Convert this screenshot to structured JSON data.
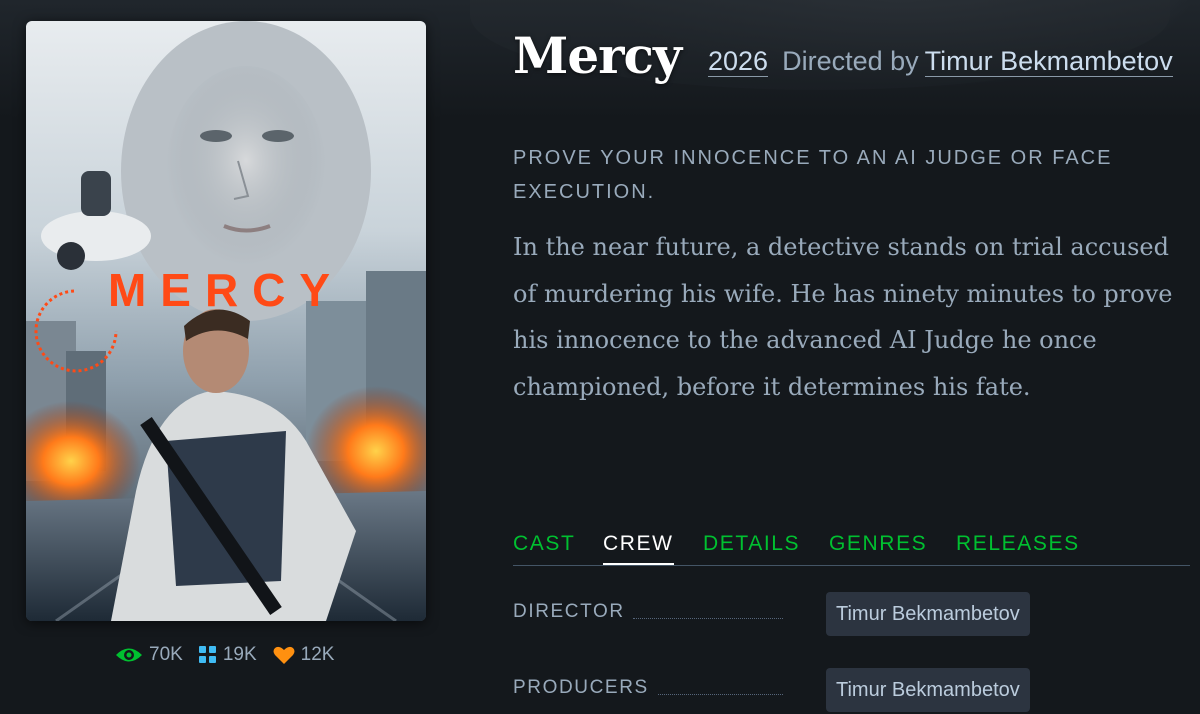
{
  "film": {
    "title": "Mercy",
    "year": "2026",
    "directed_by_label": "Directed by",
    "director_link": "Timur Bekmambetov",
    "tagline": "Prove your innocence to an AI judge or face execution.",
    "synopsis": "In the near future, a detective stands on trial accused of murdering his wife. He has ninety minutes to prove his innocence to the advanced AI Judge he once championed, before it determines his fate."
  },
  "poster": {
    "title_text": "MERCY",
    "accent_color": "#ff4a16"
  },
  "stats": [
    {
      "icon": "eye-icon",
      "value": "70K",
      "color": "#00c030"
    },
    {
      "icon": "grid-icon",
      "value": "19K",
      "color": "#40bcf4"
    },
    {
      "icon": "heart-icon",
      "value": "12K",
      "color": "#ff9010"
    }
  ],
  "tabs": [
    {
      "label": "CAST",
      "active": false
    },
    {
      "label": "CREW",
      "active": true
    },
    {
      "label": "DETAILS",
      "active": false
    },
    {
      "label": "GENRES",
      "active": false
    },
    {
      "label": "RELEASES",
      "active": false
    }
  ],
  "crew": [
    {
      "role": "DIRECTOR",
      "name": "Timur Bekmambetov"
    },
    {
      "role": "PRODUCERS",
      "name": "Timur Bekmambetov"
    }
  ],
  "colors": {
    "background": "#14181c",
    "tab_green": "#00c030",
    "text_muted": "#99aabb"
  }
}
